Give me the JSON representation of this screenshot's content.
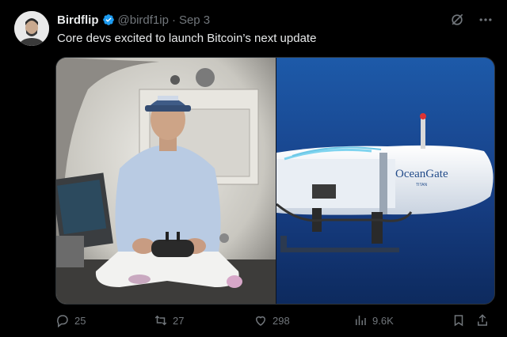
{
  "tweet": {
    "author_name": "Birdflip",
    "handle": "@birdf1ip",
    "separator": "·",
    "date": "Sep 3",
    "text": "Core devs excited to launch Bitcoin’s next update",
    "verified": true
  },
  "top_actions": {
    "grok_icon": "grok-icon",
    "more_icon": "more-icon"
  },
  "media": {
    "left_image": "man-in-submarine-with-controller",
    "right_image": "oceangate-submersible-underwater",
    "sub_logo_text": "OceanGate",
    "sub_logo_subtext": "TITAN"
  },
  "actions": {
    "replies": "25",
    "reposts": "27",
    "likes": "298",
    "views": "9.6K"
  },
  "colors": {
    "background": "#000000",
    "text_primary": "#e7e9ea",
    "text_secondary": "#71767b",
    "verified": "#1d9bf0"
  }
}
